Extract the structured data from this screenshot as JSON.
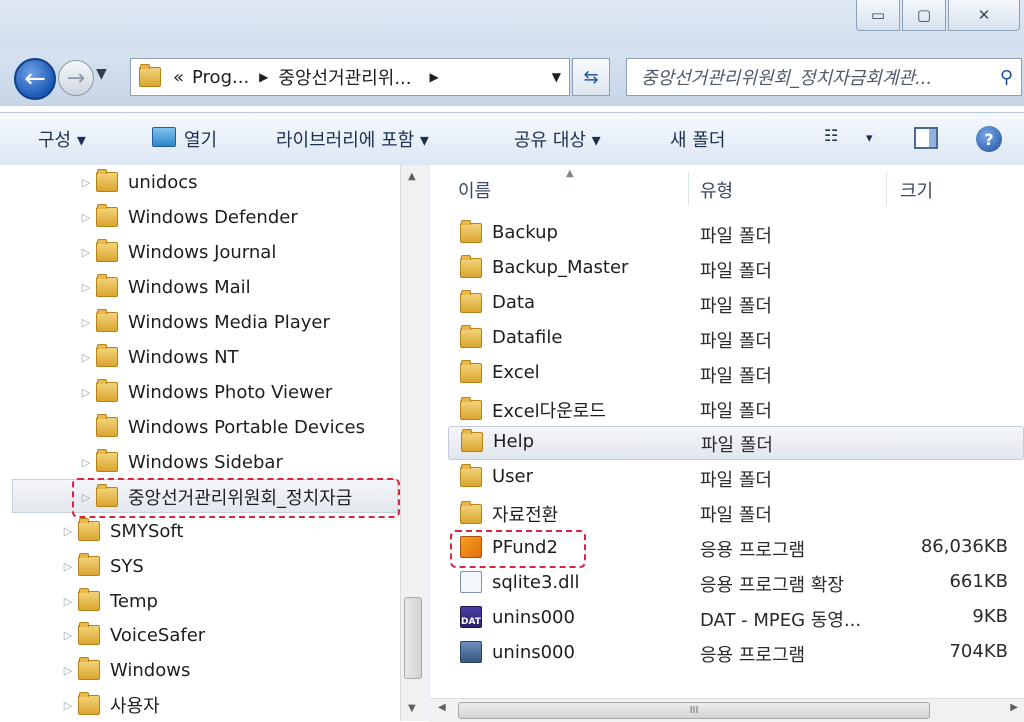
{
  "window": {
    "minimize_icon": "minimize-icon",
    "maximize_icon": "maximize-icon",
    "close_icon": "close-icon"
  },
  "address": {
    "prefix": "«",
    "crumb1": "Prog...",
    "sep": "▶",
    "crumb2": "중앙선거관리위...",
    "search_placeholder": "중앙선거관리위원회_정치자금회계관..."
  },
  "toolbar": {
    "organize": "구성 ▾",
    "open": "열기",
    "include_library": "라이브러리에 포함 ▾",
    "share_with": "공유 대상 ▾",
    "new_folder": "새 폴더",
    "view_arrow": "▾"
  },
  "tree": {
    "items": [
      {
        "label": "unidocs"
      },
      {
        "label": "Windows Defender"
      },
      {
        "label": "Windows Journal"
      },
      {
        "label": "Windows Mail"
      },
      {
        "label": "Windows Media Player"
      },
      {
        "label": "Windows NT"
      },
      {
        "label": "Windows Photo Viewer"
      },
      {
        "label": "Windows Portable Devices"
      },
      {
        "label": "Windows Sidebar"
      },
      {
        "label": "중앙선거관리위원회_정치자금"
      },
      {
        "label": "SMYSoft"
      },
      {
        "label": "SYS"
      },
      {
        "label": "Temp"
      },
      {
        "label": "VoiceSafer"
      },
      {
        "label": "Windows"
      },
      {
        "label": "사용자"
      }
    ]
  },
  "list": {
    "columns": {
      "name": "이름",
      "type": "유형",
      "size": "크기"
    },
    "rows": [
      {
        "name": "Backup",
        "type": "파일 폴더",
        "size": ""
      },
      {
        "name": "Backup_Master",
        "type": "파일 폴더",
        "size": ""
      },
      {
        "name": "Data",
        "type": "파일 폴더",
        "size": ""
      },
      {
        "name": "Datafile",
        "type": "파일 폴더",
        "size": ""
      },
      {
        "name": "Excel",
        "type": "파일 폴더",
        "size": ""
      },
      {
        "name": "Excel다운로드",
        "type": "파일 폴더",
        "size": ""
      },
      {
        "name": "Help",
        "type": "파일 폴더",
        "size": ""
      },
      {
        "name": "User",
        "type": "파일 폴더",
        "size": ""
      },
      {
        "name": "자료전환",
        "type": "파일 폴더",
        "size": ""
      },
      {
        "name": "PFund2",
        "type": "응용 프로그램",
        "size": "86,036KB"
      },
      {
        "name": "sqlite3.dll",
        "type": "응용 프로그램 확장",
        "size": "661KB"
      },
      {
        "name": "unins000",
        "type": "DAT - MPEG 동영...",
        "size": "9KB"
      },
      {
        "name": "unins000",
        "type": "응용 프로그램",
        "size": "704KB"
      }
    ]
  },
  "dat_icon_text": "DAT",
  "scroll_thumb_text": "III",
  "colors": {
    "highlight_dash": "#d7263d",
    "toolbar_text": "#1e3050"
  }
}
